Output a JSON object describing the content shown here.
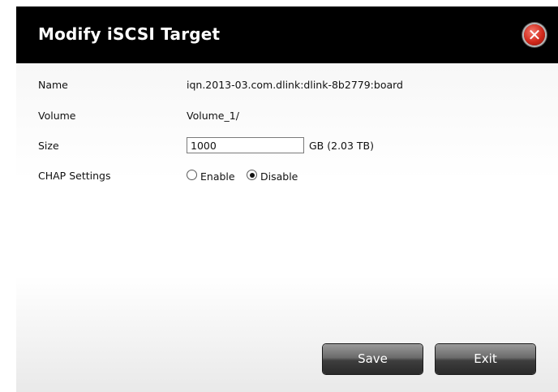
{
  "dialog": {
    "title": "Modify iSCSI Target",
    "close_icon": "close-icon"
  },
  "fields": {
    "name": {
      "label": "Name",
      "value": "iqn.2013-03.com.dlink:dlink-8b2779:board"
    },
    "volume": {
      "label": "Volume",
      "value": "Volume_1/"
    },
    "size": {
      "label": "Size",
      "value": "1000",
      "unit": "GB (2.03 TB)"
    },
    "chap": {
      "label": "CHAP Settings",
      "options": [
        "Enable",
        "Disable"
      ],
      "selected": "Disable"
    }
  },
  "buttons": {
    "save": "Save",
    "exit": "Exit"
  }
}
